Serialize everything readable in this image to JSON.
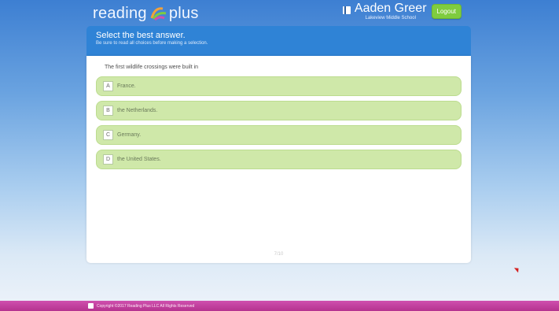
{
  "header": {
    "logo_text_left": "reading",
    "logo_text_right": "plus",
    "user_name": "Aaden Greer",
    "school": "Lakeview Middle School",
    "logout_label": "Logout"
  },
  "question": {
    "instruction_title": "Select the best answer.",
    "instruction_subtitle": "Be sure to read all choices before making a selection.",
    "prompt": "The first wildlife crossings were built in",
    "choices": [
      {
        "letter": "A",
        "text": "France."
      },
      {
        "letter": "B",
        "text": "the Netherlands."
      },
      {
        "letter": "C",
        "text": "Germany."
      },
      {
        "letter": "D",
        "text": "the United States."
      }
    ],
    "footer_label": "7/10"
  },
  "footer": {
    "copyright": "Copyright ©2017 Reading Plus LLC All Rights Reserved"
  },
  "colors": {
    "accent_blue": "#2f83d6",
    "choice_green": "#cfe8a9",
    "logout_green": "#7fcc3f",
    "footer_pink": "#c2409f"
  }
}
